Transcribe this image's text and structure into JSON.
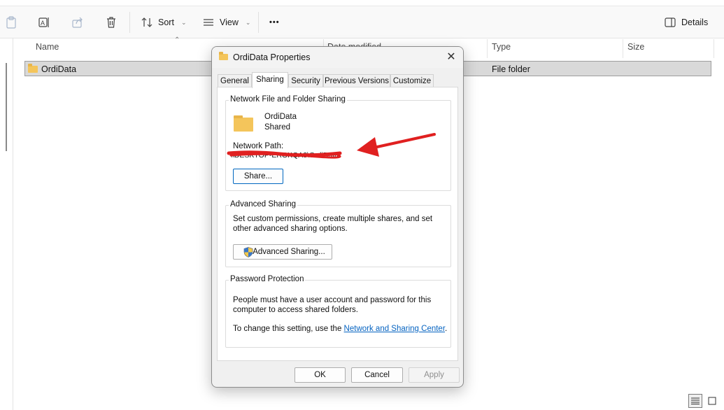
{
  "toolbar": {
    "sort_label": "Sort",
    "view_label": "View",
    "more_label": "•••",
    "details_label": "Details"
  },
  "file_list": {
    "columns": [
      "Name",
      "Date modified",
      "Type",
      "Size"
    ],
    "rows": [
      {
        "name": "OrdiData",
        "type": "File folder"
      }
    ]
  },
  "dialog": {
    "title": "OrdiData Properties",
    "tabs": [
      "General",
      "Sharing",
      "Security",
      "Previous Versions",
      "Customize"
    ],
    "active_tab": "Sharing",
    "network_sharing": {
      "group_title": "Network File and Folder Sharing",
      "folder_name": "OrdiData",
      "status": "Shared",
      "path_label": "Network Path:",
      "path_value": "\\\\DESKTOP-ERGKQA3\\OrdiData",
      "share_button": "Share..."
    },
    "advanced_sharing": {
      "group_title": "Advanced Sharing",
      "description": "Set custom permissions, create multiple shares, and set other advanced sharing options.",
      "button": "Advanced Sharing..."
    },
    "password_protection": {
      "group_title": "Password Protection",
      "description": "People must have a user account and password for this computer to access shared folders.",
      "change_prefix": "To change this setting, use the ",
      "link": "Network and Sharing Center",
      "suffix": "."
    },
    "buttons": {
      "ok": "OK",
      "cancel": "Cancel",
      "apply": "Apply"
    }
  },
  "annotation": {
    "arrow_color": "#e02020",
    "redaction_color": "#e02020"
  }
}
